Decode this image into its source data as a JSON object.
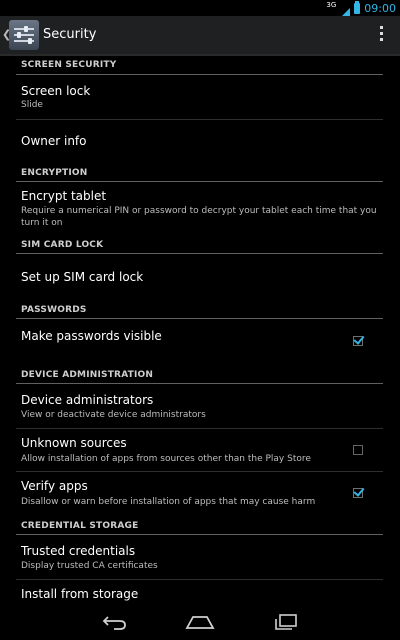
{
  "status_bar": {
    "network": "3G",
    "time": "09:00"
  },
  "action_bar": {
    "title": "Security",
    "icon": "security-settings-icon",
    "overflow_icon": "overflow-menu-icon"
  },
  "sections": {
    "screen_security": {
      "header": "SCREEN SECURITY",
      "screen_lock": {
        "title": "Screen lock",
        "summary": "Slide"
      },
      "owner_info": {
        "title": "Owner info"
      }
    },
    "encryption": {
      "header": "ENCRYPTION",
      "encrypt_tablet": {
        "title": "Encrypt tablet",
        "summary_line1": "Require a numerical PIN or password to decrypt your tablet each time that you",
        "summary_line2": "turn it on"
      }
    },
    "sim_card_lock": {
      "header": "SIM CARD LOCK",
      "set_up": {
        "title": "Set up SIM card lock"
      }
    },
    "passwords": {
      "header": "PASSWORDS",
      "make_visible": {
        "title": "Make passwords visible",
        "checked": true
      }
    },
    "device_administration": {
      "header": "DEVICE ADMINISTRATION",
      "device_admins": {
        "title": "Device administrators",
        "summary": "View or deactivate device administrators"
      },
      "unknown_sources": {
        "title": "Unknown sources",
        "summary": "Allow installation of apps from sources other than the Play Store",
        "checked": false
      },
      "verify_apps": {
        "title": "Verify apps",
        "summary": "Disallow or warn before installation of apps that may cause harm",
        "checked": true
      }
    },
    "credential_storage": {
      "header": "CREDENTIAL STORAGE",
      "trusted_credentials": {
        "title": "Trusted credentials",
        "summary": "Display trusted CA certificates"
      },
      "install_from_storage": {
        "title": "Install from storage"
      }
    }
  },
  "nav_bar": {
    "back": "back-icon",
    "home": "home-icon",
    "recents": "recents-icon"
  },
  "colors": {
    "accent": "#33b5e5",
    "background": "#000000",
    "action_bar": "#1f2022"
  }
}
